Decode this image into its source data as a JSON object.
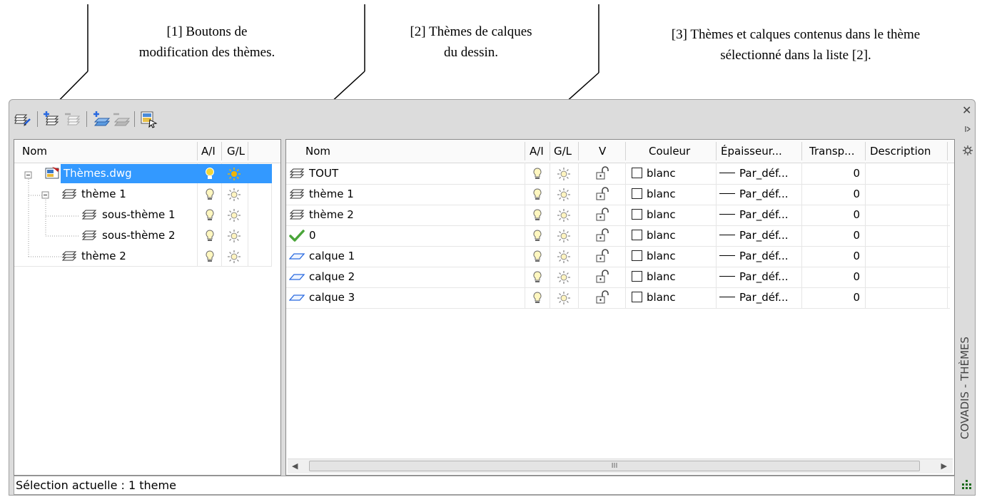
{
  "annotations": [
    {
      "text": "[1] Boutons de modification des thèmes."
    },
    {
      "text": "[2] Thèmes de calques du dessin."
    },
    {
      "text": "[3] Thèmes et calques contenus dans le thème sélectionné dans la liste [2]."
    }
  ],
  "annotation_lines": {
    "a1": [
      "[1] Boutons de",
      "modification des thèmes."
    ],
    "a2": [
      "[2] Thèmes de calques",
      "du dessin."
    ],
    "a3": [
      "[3] Thèmes et calques contenus dans le thème",
      "sélectionné dans la liste [2]."
    ]
  },
  "toolbar": {
    "buttons": [
      "theme-manager-icon",
      "new-theme-icon",
      "delete-theme-icon",
      "new-subtheme-icon",
      "delete-subtheme-icon",
      "export-themes-icon"
    ]
  },
  "left_panel": {
    "columns": {
      "name": "Nom",
      "onoff": "A/I",
      "freeze": "G/L"
    },
    "tree": [
      {
        "label": "Thèmes.dwg",
        "selected": true
      },
      {
        "label": "thème 1"
      },
      {
        "label": "sous-thème 1"
      },
      {
        "label": "sous-thème 2"
      },
      {
        "label": "thème 2"
      }
    ]
  },
  "right_panel": {
    "columns": {
      "name": "Nom",
      "onoff": "A/I",
      "freeze": "G/L",
      "lock": "V",
      "color": "Couleur",
      "lineweight": "Épaisseur...",
      "transparency": "Transp...",
      "description": "Description"
    },
    "rows": [
      {
        "icon": "theme-stack-icon",
        "name": "TOUT",
        "color": "blanc",
        "lineweight": "Par_déf...",
        "transparency": "0"
      },
      {
        "icon": "theme-stack-icon",
        "name": "thème 1",
        "color": "blanc",
        "lineweight": "Par_déf...",
        "transparency": "0"
      },
      {
        "icon": "theme-stack-icon",
        "name": "thème 2",
        "color": "blanc",
        "lineweight": "Par_déf...",
        "transparency": "0"
      },
      {
        "icon": "checkmark-icon",
        "name": "0",
        "color": "blanc",
        "lineweight": "Par_déf...",
        "transparency": "0"
      },
      {
        "icon": "layer-icon",
        "name": "calque 1",
        "color": "blanc",
        "lineweight": "Par_déf...",
        "transparency": "0"
      },
      {
        "icon": "layer-icon",
        "name": "calque 2",
        "color": "blanc",
        "lineweight": "Par_déf...",
        "transparency": "0"
      },
      {
        "icon": "layer-icon",
        "name": "calque 3",
        "color": "blanc",
        "lineweight": "Par_déf...",
        "transparency": "0"
      }
    ],
    "scroll_thumb_label": "III"
  },
  "status": {
    "text": "Sélection actuelle : 1 theme"
  },
  "palette": {
    "title": "COVADIS - THÈMES",
    "selection_color": "#3399ff",
    "bulb_color": "#f2d536",
    "sun_color": "#f2b400",
    "check_color": "#4aa53a"
  }
}
